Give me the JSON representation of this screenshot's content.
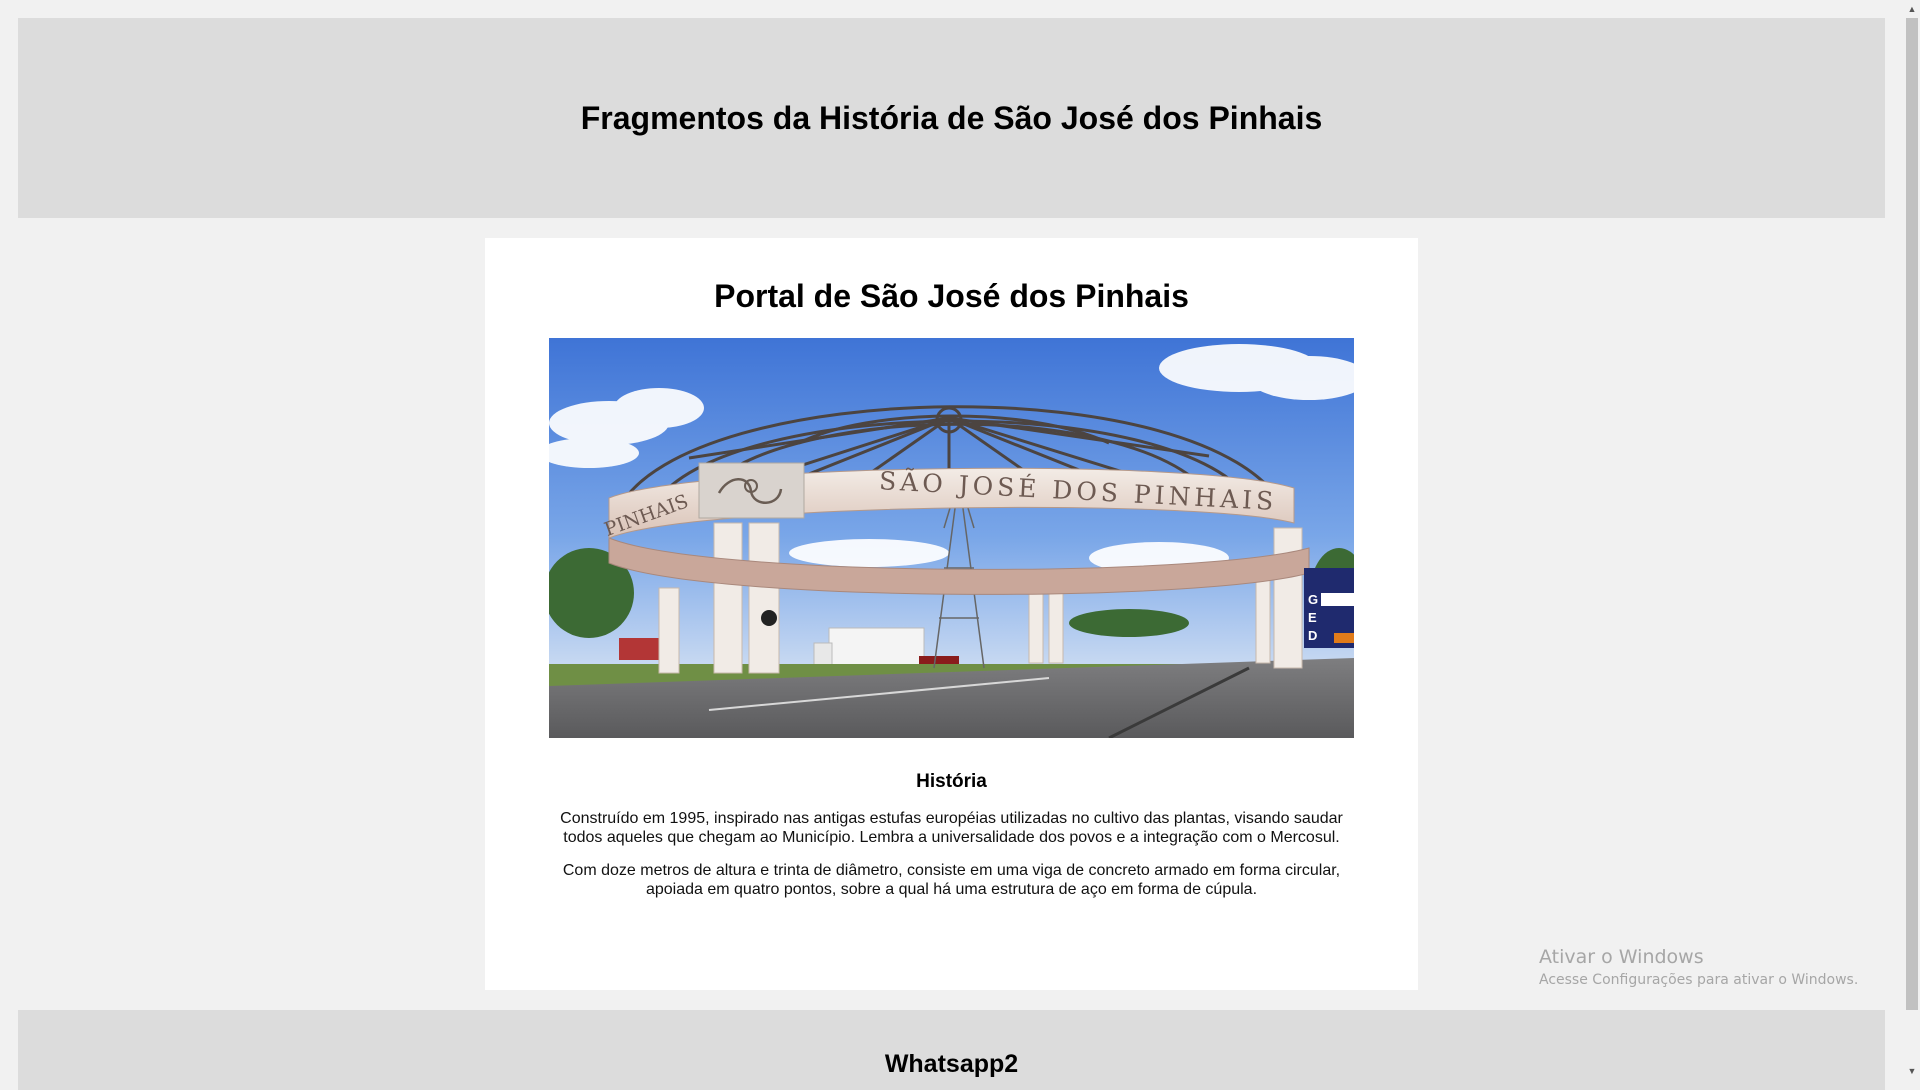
{
  "header": {
    "title": "Fragmentos da História de São José dos Pinhais"
  },
  "card": {
    "title": "Portal de São José dos Pinhais",
    "image": {
      "alt": "Portal de São José dos Pinhais",
      "arch_text": "SÃO JOSÉ DOS PINHAIS",
      "arch_text_left": "PINHAIS",
      "sign_letters": [
        "G",
        "E",
        "D"
      ]
    },
    "section_title": "História",
    "paragraphs": [
      "Construído em 1995, inspirado nas antigas estufas européias utilizadas no cultivo das plantas, visando saudar todos aqueles que chegam ao Município. Lembra a universalidade dos povos e a integração com o Mercosul.",
      "Com doze metros de altura e trinta de diâmetro, consiste em uma viga de concreto armado em forma circular, apoiada em quatro pontos, sobre a qual há uma estrutura de aço em forma de cúpula."
    ]
  },
  "footer": {
    "title": "Whatsapp2"
  },
  "watermark": {
    "title": "Ativar o Windows",
    "subtitle": "Acesse Configurações para ativar o Windows."
  },
  "colors": {
    "page_bg": "#f1f1f1",
    "band_bg": "#dcdcdc",
    "card_bg": "#ffffff"
  }
}
